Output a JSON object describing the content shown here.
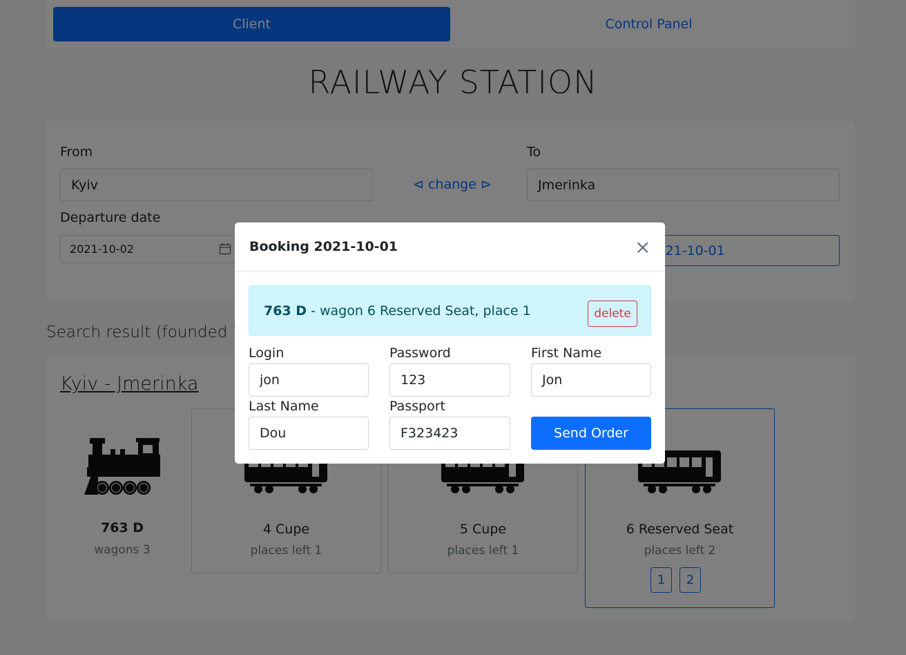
{
  "nav": {
    "client_label": "Client",
    "control_label": "Control Panel"
  },
  "page_title": "RAILWAY STATION",
  "search": {
    "from_label": "From",
    "from_value": "Kyiv",
    "change_label": "⊲ change ⊳",
    "to_label": "To",
    "to_value": "Jmerinka",
    "date_label": "Departure date",
    "date_value": "2021-10-02",
    "search_button": "Search train on 2021-10-01"
  },
  "results": {
    "heading": "Search result (founded 1) on 2021-10-01",
    "route": "Kyiv - Jmerinka",
    "train": {
      "number": "763 D",
      "wagons": "wagons 3"
    },
    "wagons": [
      {
        "title": "4 Cupe",
        "places": "places left 1"
      },
      {
        "title": "5 Cupe",
        "places": "places left 1"
      },
      {
        "title": "6 Reserved Seat",
        "places": "places left 2",
        "seats": [
          "1",
          "2"
        ]
      }
    ]
  },
  "modal": {
    "title": "Booking 2021-10-01",
    "close": "×",
    "booking_train": "763 D",
    "booking_detail": " - wagon 6 Reserved Seat, place 1",
    "delete_label": "delete",
    "fields": {
      "login_label": "Login",
      "login_value": "jon",
      "password_label": "Password",
      "password_value": "123",
      "first_name_label": "First Name",
      "first_name_value": "Jon",
      "last_name_label": "Last Name",
      "last_name_value": "Dou",
      "passport_label": "Passport",
      "passport_value": "F323423"
    },
    "send_button": "Send Order"
  },
  "colors": {
    "primary": "#0d6efd",
    "danger": "#dc3545",
    "info_bg": "#cff4fc",
    "info_text": "#055160"
  }
}
